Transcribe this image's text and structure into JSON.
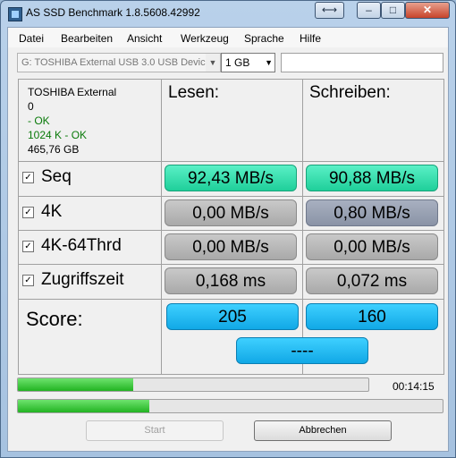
{
  "window": {
    "title": "AS SSD Benchmark 1.8.5608.42992"
  },
  "menu": [
    "Datei",
    "Bearbeiten",
    "Ansicht",
    "Werkzeug",
    "Sprache",
    "Hilfe"
  ],
  "toolbar": {
    "drive": "G: TOSHIBA External USB 3.0 USB Devic",
    "size": "1 GB"
  },
  "info": {
    "model": "TOSHIBA External",
    "firmware": "0",
    "driver_status": " - OK",
    "alignment": "1024 K - OK",
    "capacity": "465,76 GB"
  },
  "columns": {
    "read": "Lesen:",
    "write": "Schreiben:"
  },
  "rows": [
    {
      "label": "Seq",
      "checked": true,
      "read": "92,43 MB/s",
      "write": "90,88 MB/s"
    },
    {
      "label": "4K",
      "checked": true,
      "read": "0,00 MB/s",
      "write": "0,80 MB/s"
    },
    {
      "label": "4K-64Thrd",
      "checked": true,
      "read": "0,00 MB/s",
      "write": "0,00 MB/s"
    },
    {
      "label": "Zugriffszeit",
      "checked": true,
      "read": "0,168 ms",
      "write": "0,072 ms"
    }
  ],
  "score": {
    "label": "Score:",
    "read": "205",
    "write": "160",
    "total": "----"
  },
  "progress": {
    "test_fraction": 0.33,
    "overall_fraction": 0.31,
    "elapsed": "00:14:15"
  },
  "buttons": {
    "start": "Start",
    "cancel": "Abbrechen"
  },
  "colors": {
    "accent_green": "#1fcf9a",
    "score_blue": "#11a8e6",
    "progress_green": "#22b322"
  }
}
